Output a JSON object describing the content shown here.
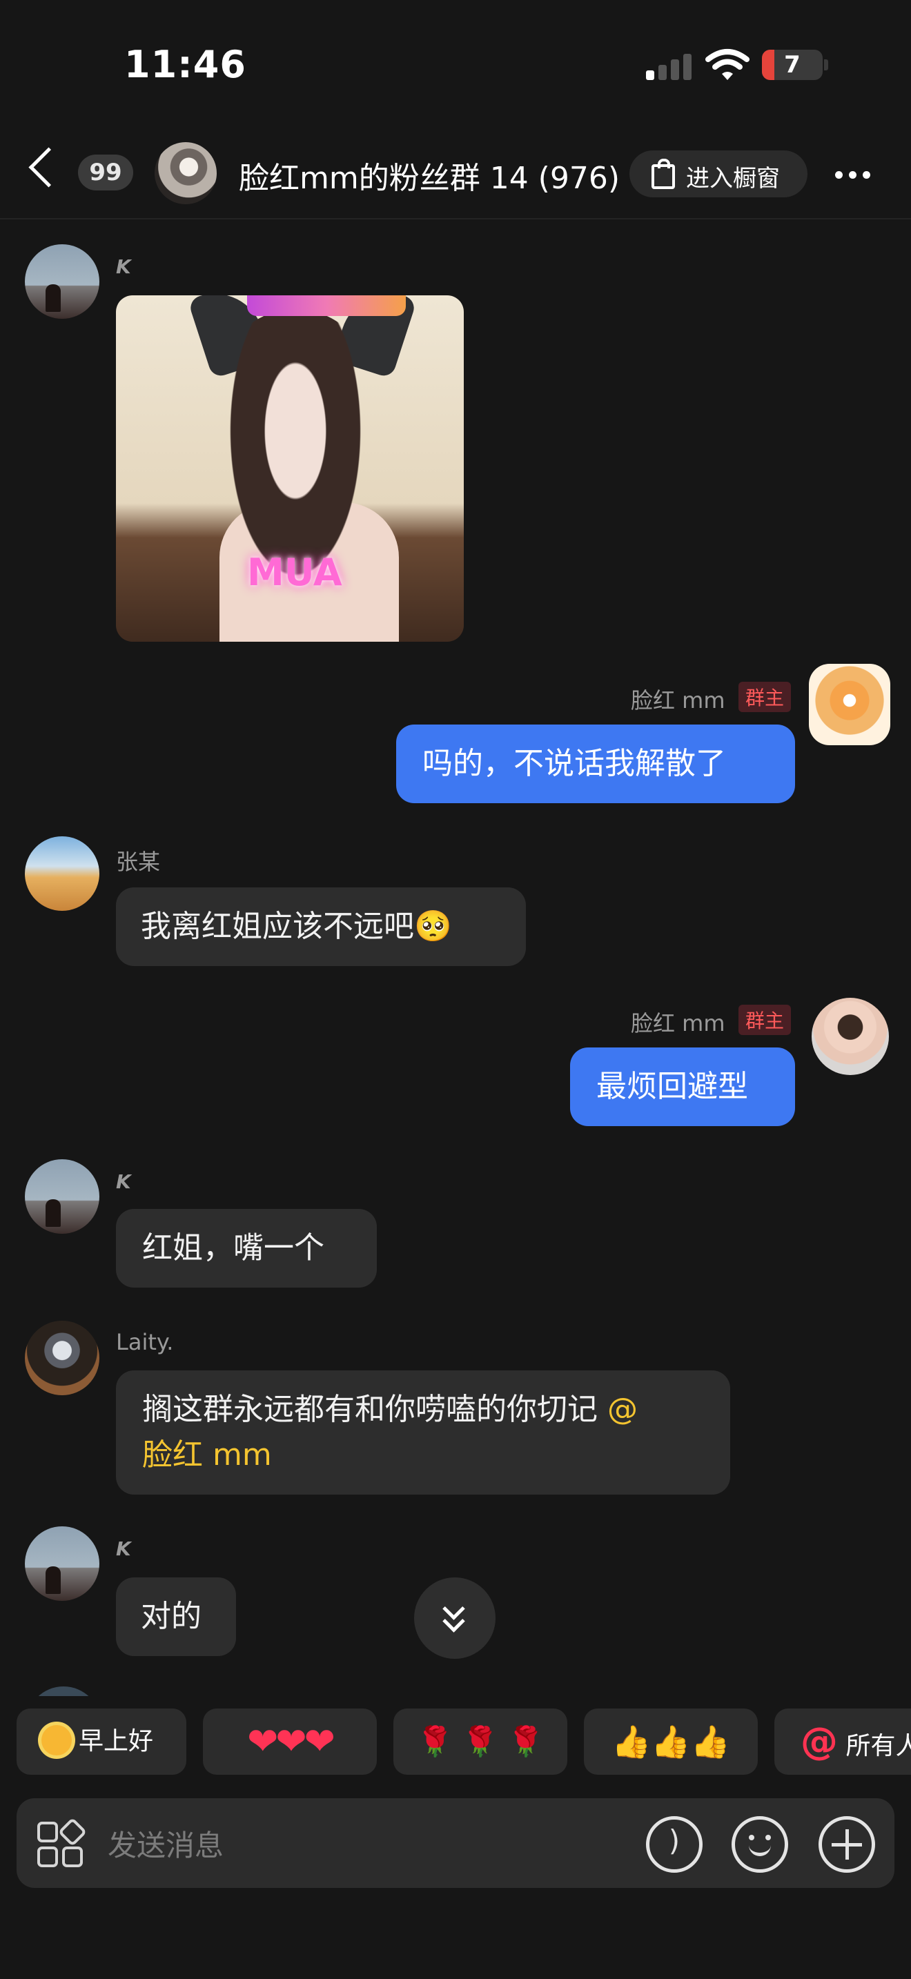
{
  "status_bar": {
    "time": "11:46",
    "battery": "7"
  },
  "header": {
    "unread_count": "99",
    "group_title": "脸红mm的粉丝群 14 (976)",
    "shop_button": "进入橱窗"
  },
  "messages": [
    {
      "sender": "K",
      "type": "image",
      "image_caption": "MUA"
    },
    {
      "sender": "脸红 mm",
      "badge": "群主",
      "text": "吗的，不说话我解散了"
    },
    {
      "sender": "张某",
      "text": "我离红姐应该不远吧🥺"
    },
    {
      "sender": "脸红 mm",
      "badge": "群主",
      "text": "最烦回避型"
    },
    {
      "sender": "K",
      "text": "红姐，嘴一个"
    },
    {
      "sender": "Laity.",
      "text_line1": "搁这群永远都有和你唠嗑的你切记",
      "mention_at": "@",
      "mention_name": "脸红 mm"
    },
    {
      "sender": "K",
      "text": "对的"
    }
  ],
  "quick_replies": [
    {
      "label": "早上好",
      "icon": "sun-icon"
    },
    {
      "glyphs": "❤❤❤",
      "icon": "heart-icon"
    },
    {
      "glyphs": "🌹 🌹 🌹",
      "icon": "rose-icon"
    },
    {
      "glyphs": "👍👍👍",
      "icon": "thumbs-up-icon"
    },
    {
      "label": "所有人",
      "prefix": "@"
    }
  ],
  "input": {
    "placeholder": "发送消息"
  },
  "colors": {
    "background": "#161616",
    "outgoing_bubble": "#3e78f2",
    "incoming_bubble": "#2d2d2d",
    "mention": "#f4c430",
    "owner_badge": "#ff5a5a"
  }
}
